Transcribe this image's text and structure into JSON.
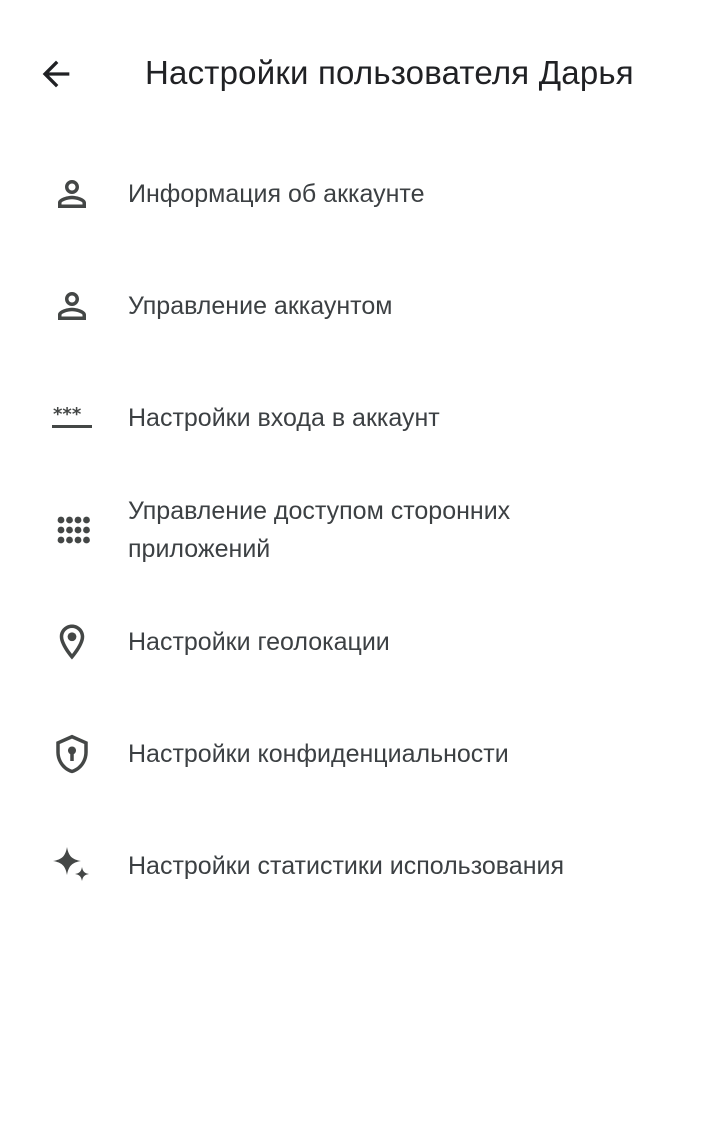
{
  "header": {
    "title": "Настройки пользователя Дарья",
    "back_icon": "arrow-back-icon"
  },
  "menu": {
    "items": [
      {
        "label": "Информация об аккаунте",
        "icon": "person-outline-icon"
      },
      {
        "label": "Управление аккаунтом",
        "icon": "person-outline-icon"
      },
      {
        "label": "Настройки входа в аккаунт",
        "icon": "password-icon"
      },
      {
        "label": "Управление доступом сторонних приложений",
        "icon": "apps-grid-icon"
      },
      {
        "label": "Настройки геолокации",
        "icon": "location-pin-icon"
      },
      {
        "label": "Настройки конфиденциальности",
        "icon": "shield-lock-icon"
      },
      {
        "label": "Настройки статистики использования",
        "icon": "sparkle-icon"
      }
    ]
  },
  "colors": {
    "text_primary": "#202124",
    "text_secondary": "#3c4043",
    "icon": "#444746",
    "background": "#ffffff"
  }
}
